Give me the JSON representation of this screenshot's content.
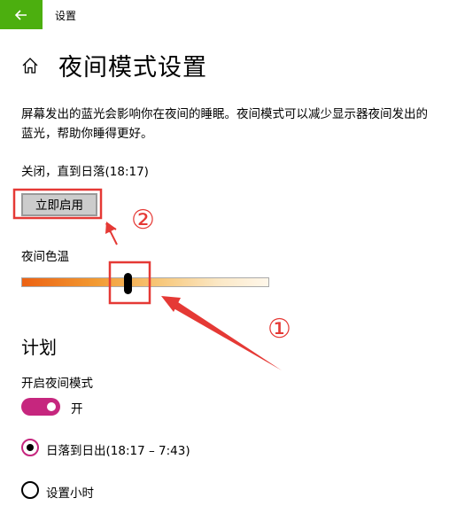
{
  "app": {
    "title": "设置",
    "back_icon": "arrow-left-icon",
    "accent_color": "#4caf0f"
  },
  "page": {
    "title": "夜间模式设置",
    "home_icon": "home-icon"
  },
  "description": "屏幕发出的蓝光会影响你在夜间的睡眠。夜间模式可以减少显示器夜间发出的蓝光，帮助你睡得更好。",
  "status": "关闭，直到日落(18:17)",
  "enable_button": {
    "label": "立即启用"
  },
  "color_temperature": {
    "label": "夜间色温",
    "level": 0.43
  },
  "schedule": {
    "title": "计划",
    "toggle_label": "开启夜间模式",
    "toggle_state": "开",
    "toggle_on": true,
    "toggle_color": "#c6267e",
    "options": [
      {
        "label": "日落到日出(18:17 – 7:43)",
        "selected": true
      },
      {
        "label": "设置小时",
        "selected": false
      }
    ]
  },
  "annotations": {
    "marker_1": "①",
    "marker_2": "②",
    "color": "#e53935"
  }
}
